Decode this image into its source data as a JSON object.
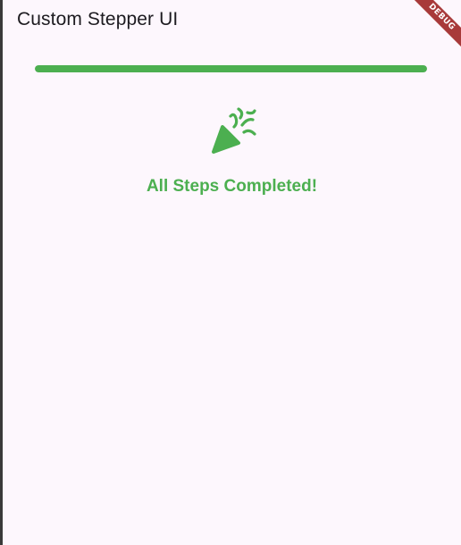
{
  "appbar": {
    "title": "Custom Stepper UI"
  },
  "progress": {
    "value": 1.0,
    "color": "#4caf50"
  },
  "completion": {
    "icon": "celebration-icon",
    "message": "All Steps Completed!",
    "color": "#4caf50"
  },
  "debug_banner": {
    "label": "DEBUG",
    "color": "#a83a3a"
  }
}
